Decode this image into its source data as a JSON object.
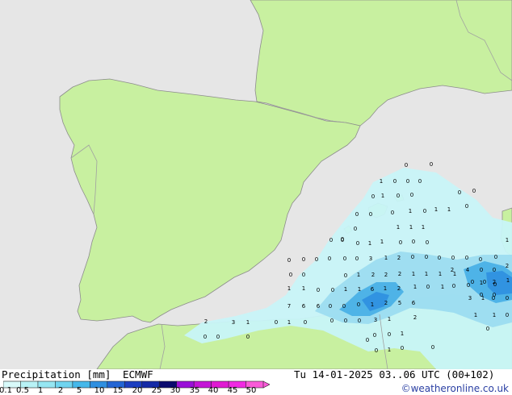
{
  "footer": {
    "left_title": "Precipitation [mm]",
    "model": "ECMWF",
    "valid_time": "Tu 14-01-2025 03..06 UTC (00+102)",
    "credit": "©weatheronline.co.uk"
  },
  "legend": {
    "ticks": [
      "0.1",
      "0.5",
      "1",
      "2",
      "5",
      "10",
      "15",
      "20",
      "25",
      "30",
      "35",
      "40",
      "45",
      "50"
    ],
    "colors": [
      "#d8fafa",
      "#b8f2f6",
      "#96e6f2",
      "#70d4ef",
      "#46b8ea",
      "#2f8fe0",
      "#2365d4",
      "#1c3fc0",
      "#142aa6",
      "#0a0a6e",
      "#9a10d8",
      "#c414d6",
      "#e01ad2",
      "#f02ae2",
      "#f95ad8"
    ]
  },
  "map": {
    "colors": {
      "sea": "#e6e6e6",
      "land": "#c8f0a0",
      "border": "#a0a0a0",
      "coast": "#8c8c8c",
      "light_precip": "#c8f4f8",
      "medium_precip": "#9cdcf0",
      "heavy_precip": "#4ab0e6"
    },
    "labels": [
      {
        "t": "0"
      },
      {
        "t": "0"
      },
      {
        "t": "1"
      },
      {
        "t": "0"
      },
      {
        "t": "0"
      },
      {
        "t": "0"
      },
      {
        "t": "0"
      },
      {
        "t": "0"
      },
      {
        "t": "0"
      },
      {
        "t": "1"
      },
      {
        "t": "0"
      },
      {
        "t": "0"
      },
      {
        "t": "0"
      },
      {
        "t": "1"
      },
      {
        "t": "1"
      },
      {
        "t": "1"
      },
      {
        "t": "0"
      },
      {
        "t": "0"
      },
      {
        "t": "0"
      },
      {
        "t": "0"
      },
      {
        "t": "0"
      },
      {
        "t": "0"
      },
      {
        "t": "1"
      },
      {
        "t": "1"
      },
      {
        "t": "1"
      },
      {
        "t": "0"
      },
      {
        "t": "0"
      },
      {
        "t": "0"
      },
      {
        "t": "0"
      },
      {
        "t": "0"
      },
      {
        "t": "0"
      },
      {
        "t": "0"
      },
      {
        "t": "0"
      },
      {
        "t": "0"
      },
      {
        "t": "1"
      },
      {
        "t": "1"
      },
      {
        "t": "0"
      },
      {
        "t": "0"
      },
      {
        "t": "0"
      },
      {
        "t": "0"
      },
      {
        "t": "0"
      },
      {
        "t": "3"
      },
      {
        "t": "1"
      },
      {
        "t": "2"
      },
      {
        "t": "0"
      },
      {
        "t": "0"
      },
      {
        "t": "0"
      },
      {
        "t": "0"
      },
      {
        "t": "0"
      },
      {
        "t": "0"
      },
      {
        "t": "0"
      },
      {
        "t": "0"
      },
      {
        "t": "0"
      },
      {
        "t": "1"
      },
      {
        "t": "2"
      },
      {
        "t": "4"
      },
      {
        "t": "2"
      },
      {
        "t": "1"
      },
      {
        "t": "1"
      },
      {
        "t": "0"
      },
      {
        "t": "0"
      },
      {
        "t": "1"
      },
      {
        "t": "2"
      },
      {
        "t": "2"
      },
      {
        "t": "2"
      },
      {
        "t": "1"
      },
      {
        "t": "1"
      },
      {
        "t": "1"
      },
      {
        "t": "1"
      },
      {
        "t": "0"
      },
      {
        "t": "0"
      },
      {
        "t": "1"
      },
      {
        "t": "2"
      },
      {
        "t": "1"
      },
      {
        "t": "0"
      },
      {
        "t": "0"
      },
      {
        "t": "1"
      },
      {
        "t": "1"
      },
      {
        "t": "6"
      },
      {
        "t": "1"
      },
      {
        "t": "2"
      },
      {
        "t": "1"
      },
      {
        "t": "0"
      },
      {
        "t": "0"
      },
      {
        "t": "0"
      },
      {
        "t": "0"
      },
      {
        "t": "0"
      },
      {
        "t": "1"
      },
      {
        "t": "7"
      },
      {
        "t": "6"
      },
      {
        "t": "6"
      },
      {
        "t": "0"
      },
      {
        "t": "0"
      },
      {
        "t": "0"
      },
      {
        "t": "1"
      },
      {
        "t": "2"
      },
      {
        "t": "5"
      },
      {
        "t": "6"
      },
      {
        "t": "3"
      },
      {
        "t": "1"
      },
      {
        "t": "0"
      },
      {
        "t": "0"
      },
      {
        "t": "2"
      },
      {
        "t": "3"
      },
      {
        "t": "1"
      },
      {
        "t": "0"
      },
      {
        "t": "1"
      },
      {
        "t": "0"
      },
      {
        "t": "0"
      },
      {
        "t": "0"
      },
      {
        "t": "0"
      },
      {
        "t": "3"
      },
      {
        "t": "1"
      },
      {
        "t": "2"
      },
      {
        "t": "1"
      },
      {
        "t": "1"
      },
      {
        "t": "0"
      },
      {
        "t": "0"
      },
      {
        "t": "0"
      },
      {
        "t": "0"
      },
      {
        "t": "0"
      },
      {
        "t": "0"
      },
      {
        "t": "1"
      },
      {
        "t": "0"
      },
      {
        "t": "0"
      },
      {
        "t": "1"
      },
      {
        "t": "0"
      },
      {
        "t": "0"
      },
      {
        "t": "0"
      },
      {
        "t": "1"
      },
      {
        "t": "0"
      },
      {
        "t": "0"
      }
    ]
  }
}
